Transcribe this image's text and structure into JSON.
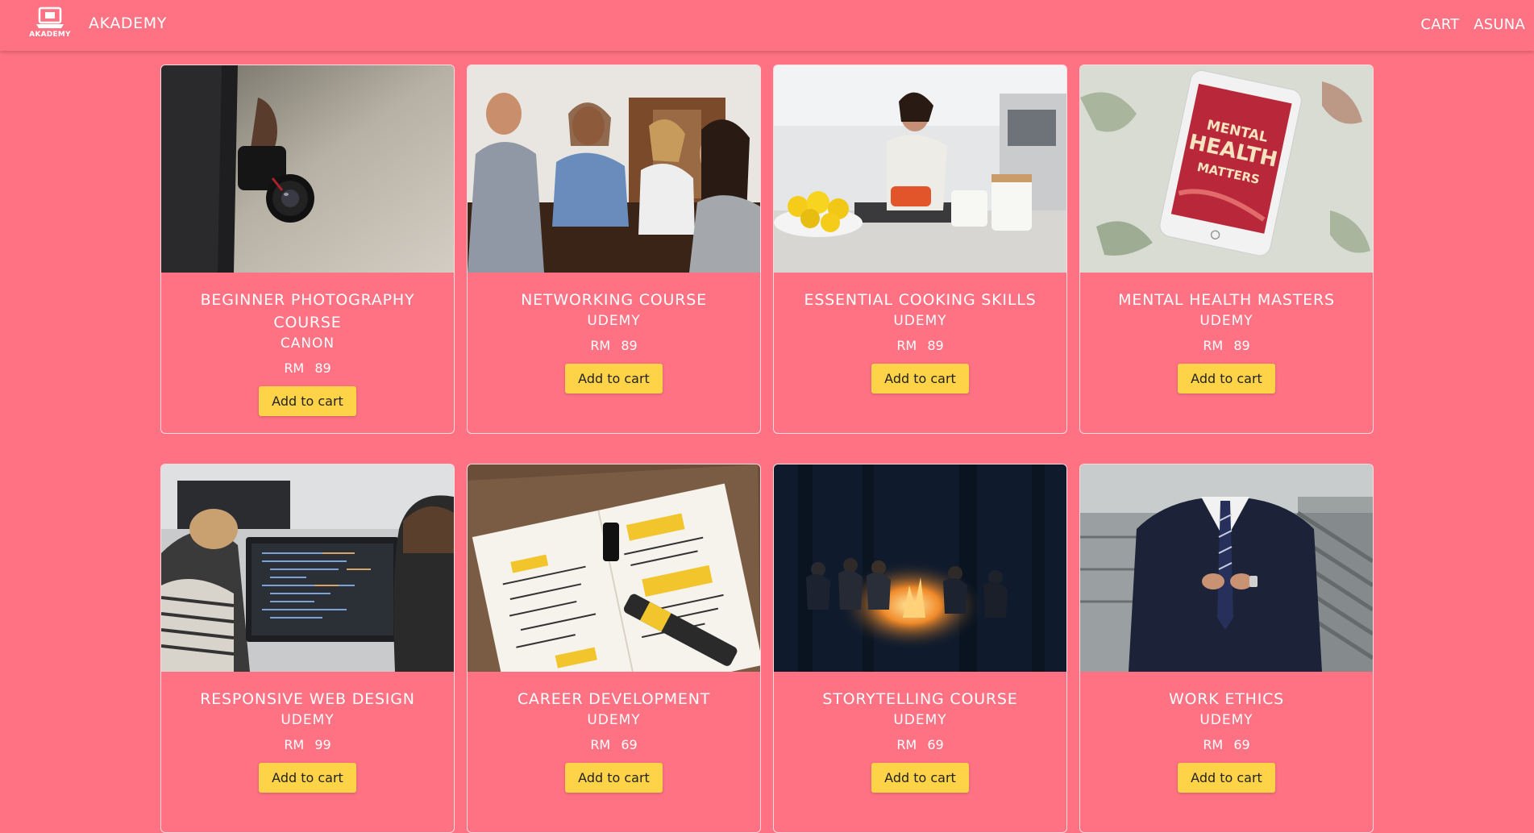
{
  "navbar": {
    "logo_text": "AKADEMY",
    "brand": "AKADEMY",
    "links": [
      "CART",
      "ASUNA"
    ]
  },
  "courses": [
    {
      "title": "BEGINNER PHOTOGRAPHY COURSE",
      "provider": "CANON",
      "currency": "RM",
      "price": "89",
      "button": "Add to cart",
      "image": "camera-photo"
    },
    {
      "title": "NETWORKING COURSE",
      "provider": "UDEMY",
      "currency": "RM",
      "price": "89",
      "button": "Add to cart",
      "image": "people-meeting-photo"
    },
    {
      "title": "ESSENTIAL COOKING SKILLS",
      "provider": "UDEMY",
      "currency": "RM",
      "price": "89",
      "button": "Add to cart",
      "image": "kitchen-cooking-photo"
    },
    {
      "title": "MENTAL HEALTH MASTERS",
      "provider": "UDEMY",
      "currency": "RM",
      "price": "89",
      "button": "Add to cart",
      "image": "tablet-mental-health-photo",
      "image_text": [
        "MENTAL",
        "HEALTH",
        "MATTERS"
      ]
    },
    {
      "title": "RESPONSIVE WEB DESIGN",
      "provider": "UDEMY",
      "currency": "RM",
      "price": "99",
      "button": "Add to cart",
      "image": "coding-monitor-photo"
    },
    {
      "title": "CAREER DEVELOPMENT",
      "provider": "UDEMY",
      "currency": "RM",
      "price": "69",
      "button": "Add to cart",
      "image": "notebook-goals-photo"
    },
    {
      "title": "STORYTELLING COURSE",
      "provider": "UDEMY",
      "currency": "RM",
      "price": "69",
      "button": "Add to cart",
      "image": "campfire-photo"
    },
    {
      "title": "WORK ETHICS",
      "provider": "UDEMY",
      "currency": "RM",
      "price": "69",
      "button": "Add to cart",
      "image": "business-suit-photo"
    }
  ],
  "colors": {
    "background": "#fe7283",
    "button": "#ffd348",
    "text": "#ffffff"
  }
}
